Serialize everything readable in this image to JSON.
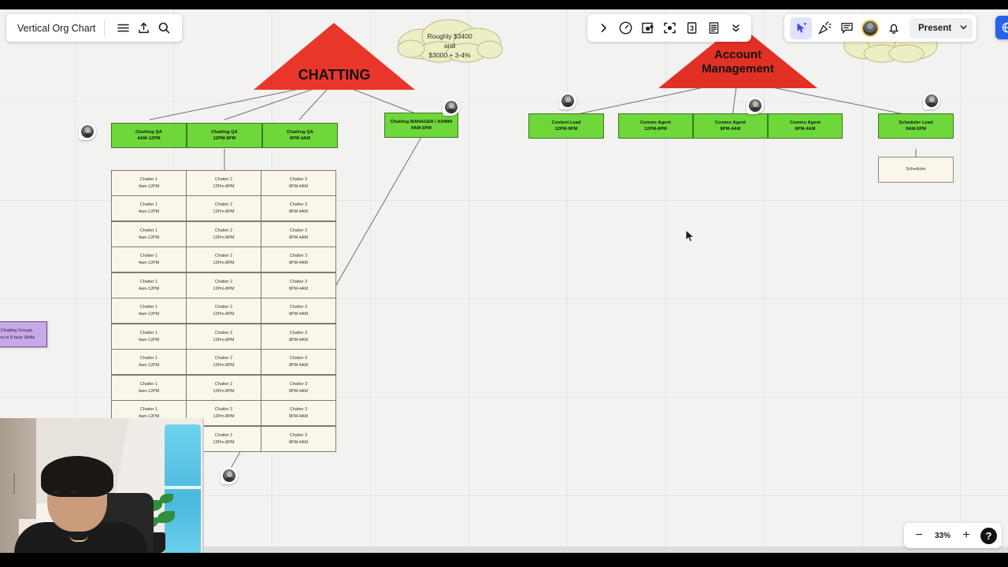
{
  "app": {
    "doc_title": "Vertical Org Chart",
    "menu_icon": "hamburger-menu-icon",
    "share_icon": "upload-share-icon",
    "search_icon": "search-icon"
  },
  "toolbar": {
    "expand_label": "›",
    "items": [
      {
        "name": "timer-icon",
        "label": ""
      },
      {
        "name": "frame-icon",
        "label": ""
      },
      {
        "name": "focus-icon",
        "label": ""
      },
      {
        "name": "slide-number-icon",
        "label": "3"
      },
      {
        "name": "notes-icon",
        "label": ""
      },
      {
        "name": "chevrons-down-icon",
        "label": ""
      }
    ],
    "cursor_tool": "cursor-select-icon",
    "celebrate_tool": "confetti-icon",
    "comment_tool": "comment-icon",
    "avatar_tool": "user-avatar",
    "notifications": "bell-icon",
    "present_label": "Present",
    "present_chevron": "chevron-down-icon",
    "share_button": "share-globe-icon"
  },
  "zoom": {
    "minus": "−",
    "value": "33%",
    "plus": "+",
    "help": "?"
  },
  "canvas": {
    "triangles": [
      {
        "name": "chatting-triangle",
        "label": "CHATTING",
        "color": "#e8372a"
      },
      {
        "name": "account-management-triangle",
        "label_line1": "Account",
        "label_line2": "Management",
        "color": "#e03124"
      }
    ],
    "clouds": [
      {
        "name": "cost-cloud",
        "line1": "Roughly $3400",
        "line2": "and",
        "line3": "$3000 + 3-4%",
        "color": "#eeeec4"
      },
      {
        "name": "secondary-cloud",
        "line1": "",
        "color": "#eeeec4"
      }
    ],
    "purple_note": {
      "name": "chatting-groups-note",
      "line1": "Chatting Groups",
      "line2": "ers in 8 hour Shifts",
      "color": "#c9a8e8"
    },
    "qa_row": [
      {
        "title": "Chatting QA",
        "hours": "4AM-12PM"
      },
      {
        "title": "Chatting QA",
        "hours": "12PM-8PM"
      },
      {
        "title": "Chatting QA",
        "hours": "8PM-4AM"
      }
    ],
    "manager_node": {
      "title": "Chatting MANAGER / ADMIN",
      "hours": "9AM-5PM"
    },
    "content_lead_node": {
      "title": "Content Lead",
      "hours": "12PM-8PM"
    },
    "comms_row": [
      {
        "title": "Comms Agent",
        "hours": "12PM-8PM"
      },
      {
        "title": "Comms Agent",
        "hours": "8PM-4AM"
      },
      {
        "title": "Comms Agent",
        "hours": "8PM-4AM"
      }
    ],
    "scheduler_lead_node": {
      "title": "Scheduler Lead",
      "hours": "9AM-5PM"
    },
    "scheduler_node": {
      "title": "Scheduler"
    },
    "chatter_columns": [
      {
        "title": "Chatter 1",
        "hours": "4am-12PM"
      },
      {
        "title": "Chatter 2",
        "hours": "12Pm-8PM"
      },
      {
        "title": "Chatter 3",
        "hours": "8PM-4AM"
      }
    ],
    "chatter_row_count": 11,
    "node_color": "#6ed73a",
    "beige_color": "#faf6ea"
  }
}
